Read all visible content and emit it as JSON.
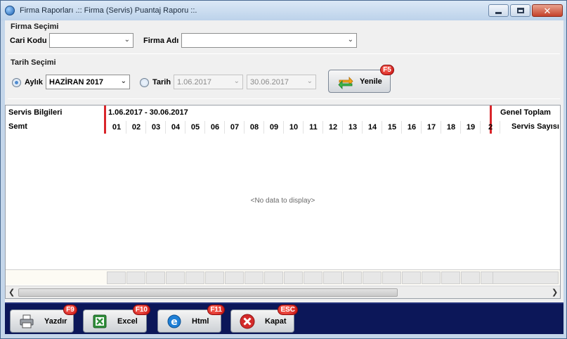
{
  "window": {
    "title": "Firma Raporları .:: Firma (Servis) Puantaj Raporu ::."
  },
  "firma": {
    "group_title": "Firma Seçimi",
    "cari_kodu_label": "Cari Kodu",
    "cari_kodu_value": "",
    "firma_adi_label": "Firma Adı",
    "firma_adi_value": ""
  },
  "tarih": {
    "group_title": "Tarih Seçimi",
    "aylik_label": "Aylık",
    "aylik_value": "HAZİRAN 2017",
    "tarih_label": "Tarih",
    "start_date": "1.06.2017",
    "end_date": "30.06.2017",
    "selected_mode": "aylik"
  },
  "refresh": {
    "label": "Yenile",
    "shortcut": "F5"
  },
  "grid": {
    "band_servis": "Servis Bilgileri",
    "band_range": "1.06.2017 - 30.06.2017",
    "band_total": "Genel Toplam",
    "col_semt": "Semt",
    "col_total": "Servis Sayısı",
    "days": [
      "01",
      "02",
      "03",
      "04",
      "05",
      "06",
      "07",
      "08",
      "09",
      "10",
      "11",
      "12",
      "13",
      "14",
      "15",
      "16",
      "17",
      "18",
      "19",
      "2"
    ],
    "empty_text": "<No data to display>"
  },
  "actions": [
    {
      "label": "Yazdır",
      "shortcut": "F9",
      "icon": "printer-icon"
    },
    {
      "label": "Excel",
      "shortcut": "F10",
      "icon": "excel-icon"
    },
    {
      "label": "Html",
      "shortcut": "F11",
      "icon": "ie-icon"
    },
    {
      "label": "Kapat",
      "shortcut": "ESC",
      "icon": "close-icon"
    }
  ]
}
